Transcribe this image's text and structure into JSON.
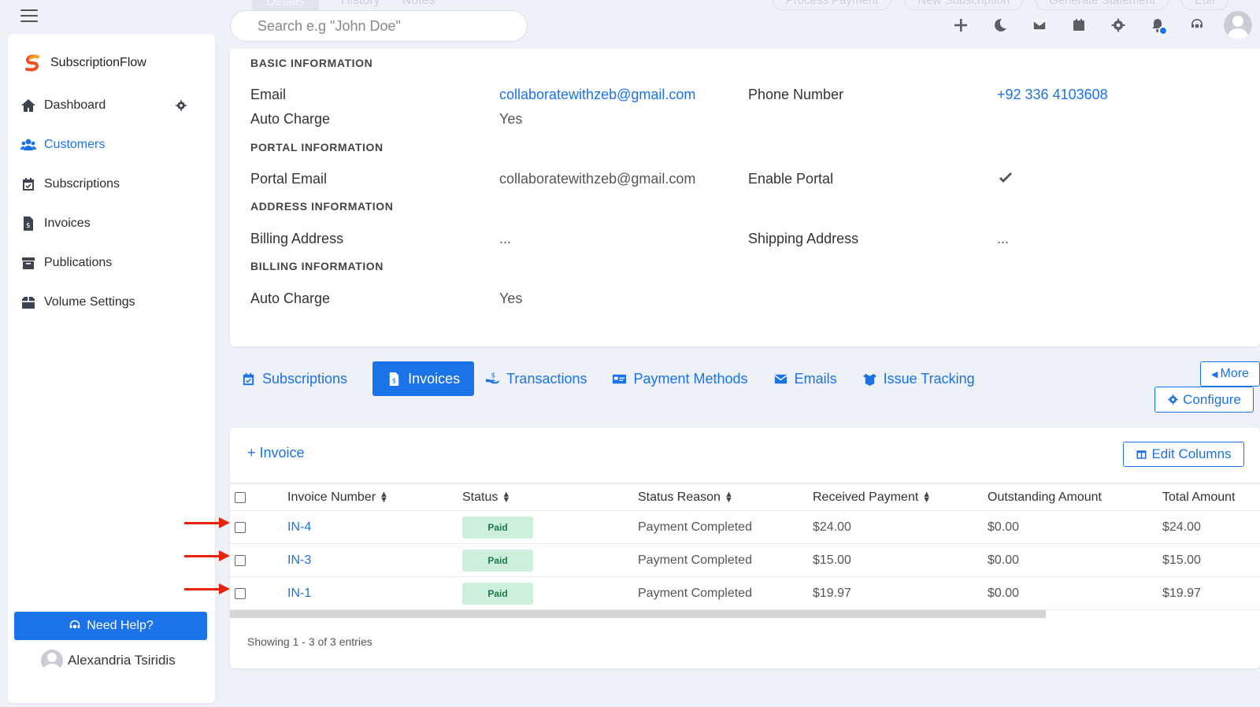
{
  "search": {
    "placeholder": "Search e.g \"John Doe\""
  },
  "ghost_tabs": [
    "Details",
    "History",
    "Notes"
  ],
  "ghost_actions": [
    "Process Payment",
    "New Subscription",
    "Generate Statement",
    "Edit"
  ],
  "brand": {
    "name": "SubscriptionFlow"
  },
  "sidebar": {
    "items": [
      {
        "label": "Dashboard",
        "icon": "home-icon"
      },
      {
        "label": "Customers",
        "icon": "users-icon",
        "active": true
      },
      {
        "label": "Subscriptions",
        "icon": "calendar-check-icon"
      },
      {
        "label": "Invoices",
        "icon": "invoice-icon"
      },
      {
        "label": "Publications",
        "icon": "archive-icon"
      },
      {
        "label": "Volume Settings",
        "icon": "box-icon"
      }
    ],
    "help_label": "Need Help?",
    "user_name": "Alexandria Tsiridis"
  },
  "info": {
    "basic_title": "BASIC INFORMATION",
    "email_label": "Email",
    "email_value": "collaboratewithzeb@gmail.com",
    "phone_label": "Phone Number",
    "phone_value": "+92 336 4103608",
    "autocharge_label": "Auto Charge",
    "autocharge_value": "Yes",
    "portal_title": "PORTAL INFORMATION",
    "portal_email_label": "Portal Email",
    "portal_email_value": "collaboratewithzeb@gmail.com",
    "enable_portal_label": "Enable Portal",
    "address_title": "ADDRESS INFORMATION",
    "billing_address_label": "Billing Address",
    "billing_address_value": "...",
    "shipping_address_label": "Shipping Address",
    "shipping_address_value": "...",
    "billing_title": "BILLING INFORMATION",
    "billing_autocharge_label": "Auto Charge",
    "billing_autocharge_value": "Yes"
  },
  "tabs": [
    {
      "label": "Subscriptions",
      "icon": "calendar-check-icon"
    },
    {
      "label": "Invoices",
      "icon": "invoice-icon",
      "active": true
    },
    {
      "label": "Transactions",
      "icon": "hand-dollar-icon"
    },
    {
      "label": "Payment Methods",
      "icon": "card-icon"
    },
    {
      "label": "Emails",
      "icon": "envelope-icon"
    },
    {
      "label": "Issue Tracking",
      "icon": "box-open-icon"
    }
  ],
  "more_label": "More",
  "configure_label": "Configure",
  "invoices": {
    "add_label": "+ Invoice",
    "edit_columns_label": "Edit Columns",
    "headers": [
      "Invoice Number",
      "Status",
      "Status Reason",
      "Received Payment",
      "Outstanding Amount",
      "Total Amount"
    ],
    "rows": [
      {
        "number": "IN-4",
        "status": "Paid",
        "reason": "Payment Completed",
        "received": "$24.00",
        "outstanding": "$0.00",
        "total": "$24.00"
      },
      {
        "number": "IN-3",
        "status": "Paid",
        "reason": "Payment Completed",
        "received": "$15.00",
        "outstanding": "$0.00",
        "total": "$15.00"
      },
      {
        "number": "IN-1",
        "status": "Paid",
        "reason": "Payment Completed",
        "received": "$19.97",
        "outstanding": "$0.00",
        "total": "$19.97"
      }
    ],
    "showing": "Showing 1 - 3 of 3 entries"
  },
  "colors": {
    "accent": "#1a73e8",
    "paid_bg": "#cdf0dc",
    "paid_text": "#1b7a45",
    "annotation_arrow": "#e8230c"
  }
}
